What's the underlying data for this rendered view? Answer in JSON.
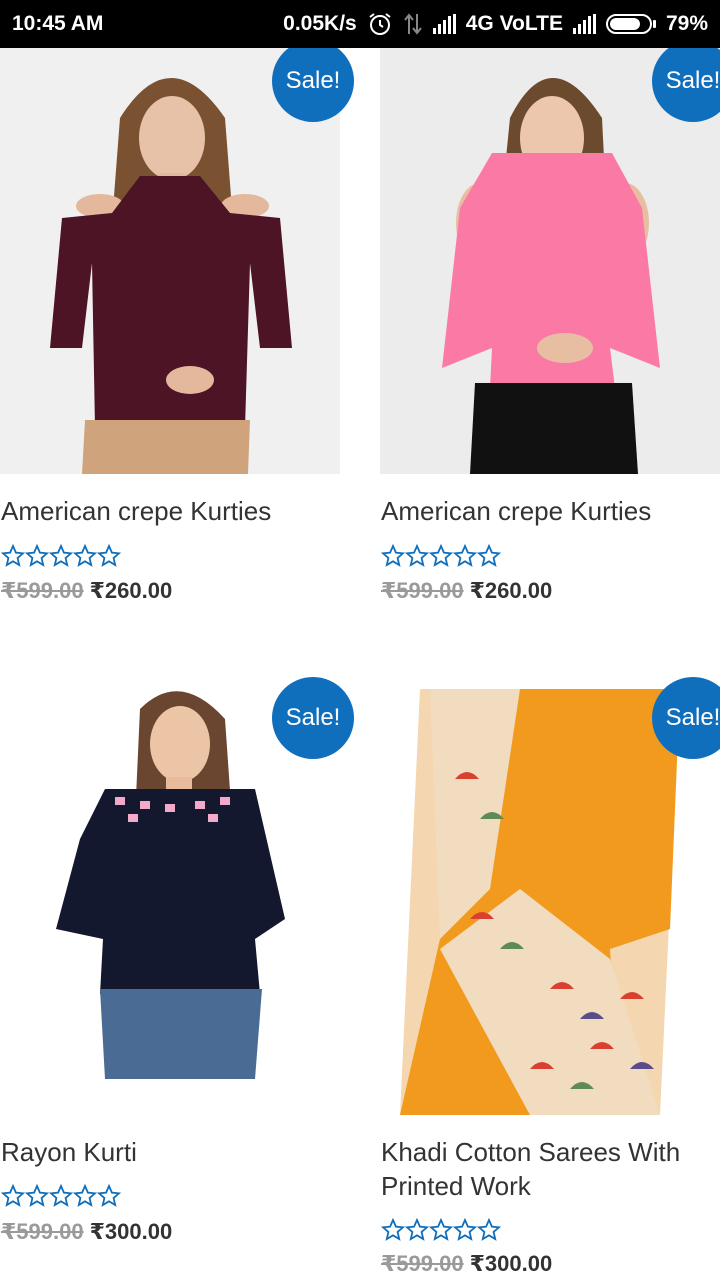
{
  "status_bar": {
    "time": "10:45 AM",
    "net_speed": "0.05K/s",
    "network": "4G VoLTE",
    "battery": "79%",
    "battery_level": 0.79
  },
  "icons": [
    "alarm-icon",
    "data-arrows-icon",
    "signal-icon",
    "battery-icon",
    "star-icon"
  ],
  "colors": {
    "sale_badge": "#0f6fbd",
    "star_outline": "#0f6fbd",
    "old_price": "#9a9a9a",
    "title": "#333333"
  },
  "products": [
    {
      "badge": "Sale!",
      "title": "American crepe Kurties",
      "rating": 0,
      "old_price": "₹599.00",
      "new_price": "₹260.00",
      "image": "woman-maroon-cold-shoulder-top"
    },
    {
      "badge": "Sale!",
      "title": "American crepe Kurties",
      "rating": 0,
      "old_price": "₹599.00",
      "new_price": "₹260.00",
      "image": "woman-pink-cold-shoulder-top"
    },
    {
      "badge": "Sale!",
      "title": "Rayon Kurti",
      "rating": 0,
      "old_price": "₹599.00",
      "new_price": "₹300.00",
      "image": "woman-navy-embroidered-top"
    },
    {
      "badge": "Sale!",
      "title": "Khadi Cotton Sarees With Printed Work",
      "rating": 0,
      "old_price": "₹599.00",
      "new_price": "₹300.00",
      "image": "orange-saree-umbrella-print"
    }
  ]
}
